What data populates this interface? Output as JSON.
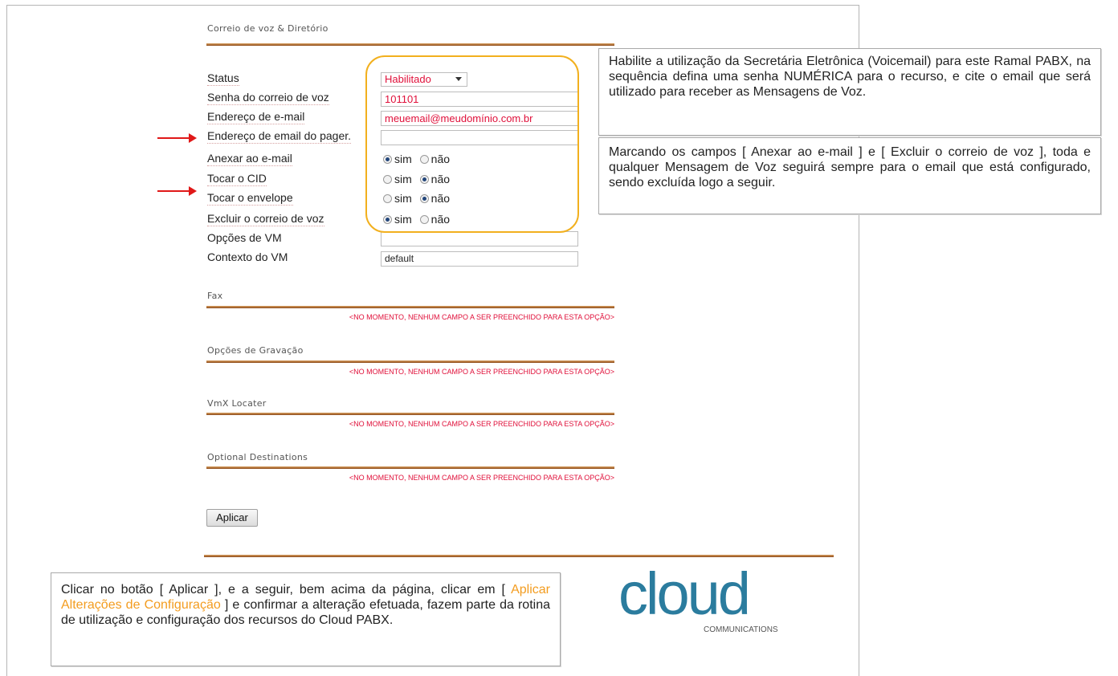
{
  "voicemail": {
    "title": "Correio de voz & Diretório",
    "status_label": "Status",
    "status_value": "Habilitado",
    "password_label": "Senha do correio de voz",
    "password_value": "101101",
    "email_label": "Endereço de e-mail",
    "email_value": "meuemail@meudomínio.com.br",
    "pager_label": "Endereço de email do pager.",
    "pager_value": "",
    "attach_label": "Anexar ao e-mail",
    "cid_label": "Tocar o CID",
    "envelope_label": "Tocar o envelope",
    "delete_label": "Excluir o correio de voz",
    "vm_options_label": "Opções de VM",
    "vm_options_value": "",
    "vm_context_label": "Contexto do VM",
    "vm_context_value": "default",
    "yes": "sim",
    "no": "não"
  },
  "sections": {
    "fax": "Fax",
    "recording": "Opções de Gravação",
    "vmx": "VmX Locater",
    "optional": "Optional Destinations",
    "empty_note": "<NO MOMENTO, NENHUM CAMPO A SER PREENCHIDO PARA ESTA OPÇÃO>"
  },
  "apply_button": "Aplicar",
  "callouts": {
    "voicemail_help": "Habilite a utilização da Secretária Eletrônica (Voicemail) para este Ramal PABX, na sequência defina uma senha NUMÉRICA para o recurso, e cite o email que será utilizado para receber as Mensagens de Voz.",
    "attach_help": "Marcando os campos [ Anexar ao e-mail ] e [ Excluir o correio de voz ], toda e qualquer Mensagem de Voz seguirá sempre para o email que está configurado, sendo excluída logo a seguir.",
    "apply_help_before": "Clicar no botão [ Aplicar ], e a seguir, bem acima da página, clicar em [ ",
    "apply_help_link": "Aplicar Alterações de Configuração",
    "apply_help_after": " ] e confirmar a alteração efetuada, fazem parte da rotina de utilização e configuração dos recursos do Cloud PABX."
  },
  "logo": {
    "word": "cloud",
    "sub": "COMMUNICATIONS"
  },
  "colors": {
    "accent_red": "#e0103a",
    "highlight": "#f2b01e",
    "rule": "#8b4a1a",
    "logo_blue": "#2b7c9e"
  }
}
